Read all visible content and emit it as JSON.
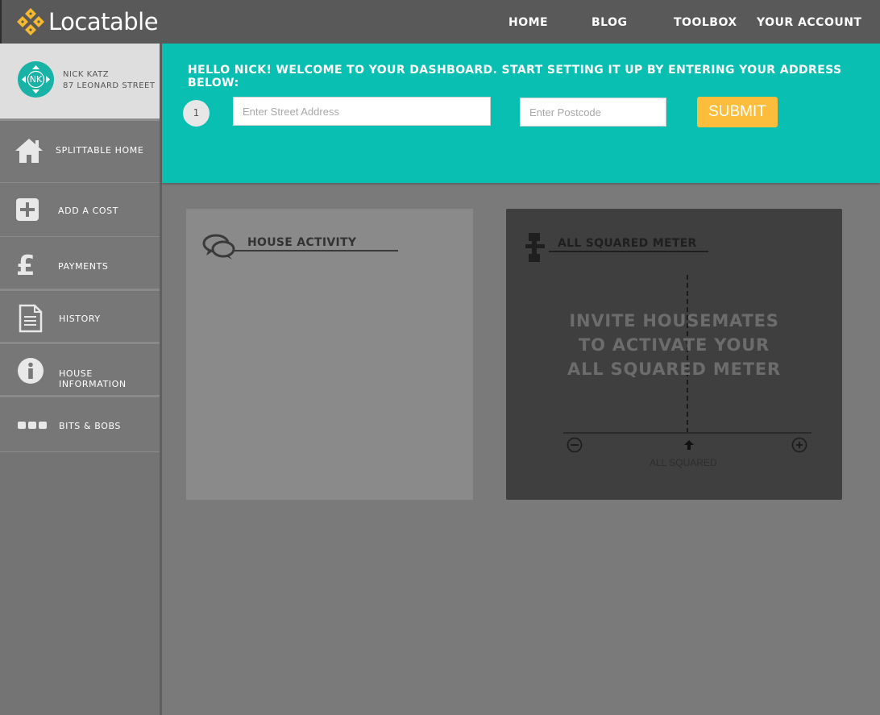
{
  "brand": {
    "name": "Locatable"
  },
  "nav": {
    "home": "HOME",
    "blog": "BLOG",
    "toolbox": "TOOLBOX",
    "account": "YOUR ACCOUNT"
  },
  "profile": {
    "initials": "NK",
    "name": "NICK KATZ",
    "address": "87 LEONARD STREET"
  },
  "sidebar": {
    "items": [
      {
        "label": "SPLITTABLE HOME",
        "icon": "home-icon"
      },
      {
        "label": "ADD A COST",
        "icon": "plus-square-icon"
      },
      {
        "label": "PAYMENTS",
        "icon": "pound-icon"
      },
      {
        "label": "HISTORY",
        "icon": "document-icon"
      },
      {
        "label": "HOUSE INFORMATION",
        "icon": "info-icon"
      },
      {
        "label": "BITS & BOBS",
        "icon": "dots-icon"
      }
    ]
  },
  "setup": {
    "welcome": "HELLO NICK! WELCOME TO YOUR DASHBOARD. START SETTING IT UP BY ENTERING YOUR ADDRESS BELOW:",
    "step": "1",
    "street_placeholder": "Enter Street Address",
    "postcode_placeholder": "Enter Postcode",
    "submit": "SUBMIT"
  },
  "activity": {
    "title": "HOUSE ACTIVITY",
    "icon": "chat-bubbles-icon"
  },
  "meter": {
    "title": "ALL SQUARED METER",
    "icon": "balance-icon",
    "invite_line1": "INVITE HOUSEMATES",
    "invite_line2": "TO ACTIVATE YOUR",
    "invite_line3": "ALL SQUARED METER",
    "center_label": "ALL SQUARED"
  },
  "colors": {
    "topbar": "#595959",
    "teal": "#08bfb1",
    "submit": "#fdbd3c",
    "logo_gold": "#f5b82e"
  }
}
